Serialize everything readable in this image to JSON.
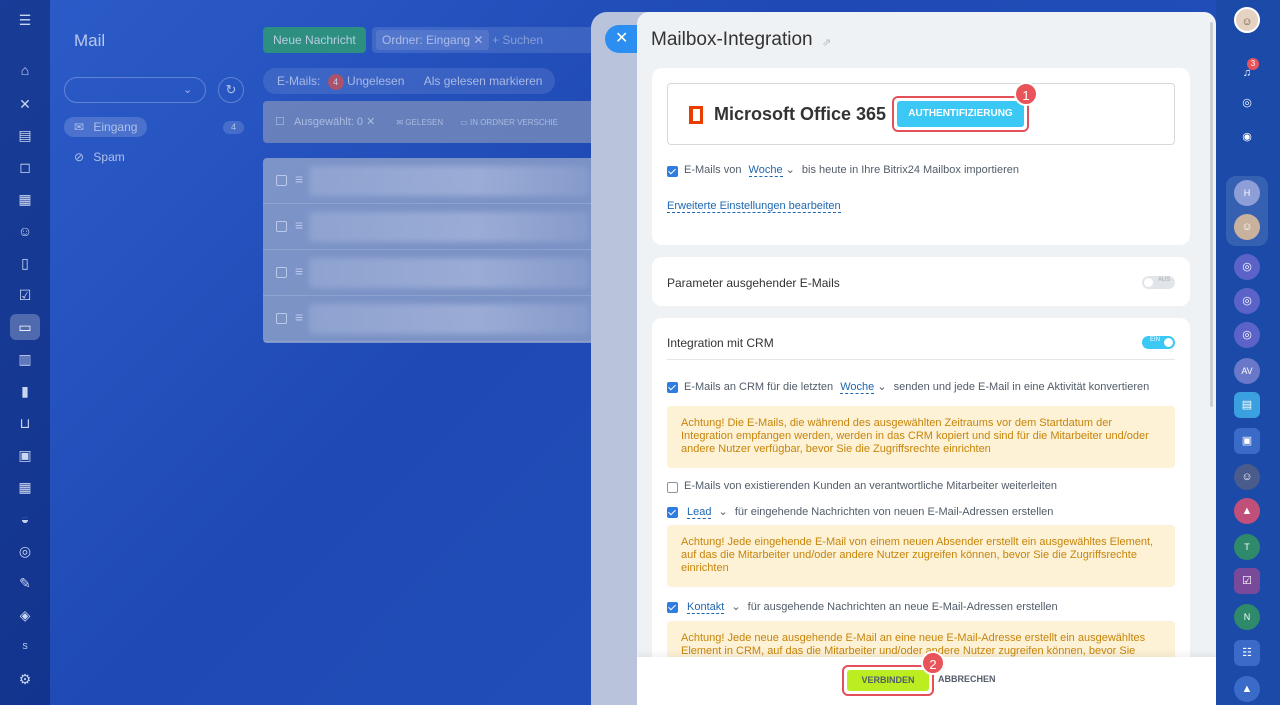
{
  "mail": {
    "title": "Mail",
    "new_message": "Neue Nachricht",
    "search_tag": "Ordner: Eingang",
    "search_placeholder": "+ Suchen",
    "filter_label": "E-Mails:",
    "unread_count": "4",
    "unread_label": "Ungelesen",
    "mark_read": "Als gelesen markieren",
    "folders": [
      {
        "label": "Eingang",
        "count": "4"
      },
      {
        "label": "Spam"
      }
    ],
    "action_bar": {
      "selected": "Ausgewählt: 0",
      "read": "GELESEN",
      "move": "IN ORDNER VERSCHIE"
    }
  },
  "panel": {
    "title": "Mailbox-Integration",
    "provider": "Microsoft Office 365",
    "auth_button": "AUTHENTIFIZIERUNG",
    "step1": "1",
    "import": {
      "prefix": "E-Mails von",
      "period": "Woche",
      "suffix": "bis heute in Ihre Bitrix24 Mailbox importieren"
    },
    "advanced_link": "Erweiterte Einstellungen bearbeiten",
    "outgoing": {
      "title": "Parameter ausgehender E-Mails",
      "toggle": "AUS"
    },
    "crm": {
      "title": "Integration mit CRM",
      "toggle": "EIN",
      "send": {
        "prefix": "E-Mails an CRM für die letzten",
        "period": "Woche",
        "suffix": "senden und jede E-Mail in eine Aktivität konvertieren"
      },
      "warning1": "Achtung! Die E-Mails, die während des ausgewählten Zeitraums vor dem Startdatum der Integration empfangen werden, werden in das CRM kopiert und sind für die Mitarbeiter und/oder andere Nutzer verfügbar, bevor Sie die Zugriffsrechte einrichten",
      "forward": "E-Mails von existierenden Kunden an verantwortliche Mitarbeiter weiterleiten",
      "lead": {
        "entity": "Lead",
        "suffix": "für eingehende Nachrichten von neuen E-Mail-Adressen erstellen"
      },
      "warning2": "Achtung! Jede eingehende E-Mail von einem neuen Absender erstellt ein ausgewähltes Element, auf das die Mitarbeiter und/oder andere Nutzer zugreifen können, bevor Sie die Zugriffsrechte einrichten",
      "contact": {
        "entity": "Kontakt",
        "suffix": "für ausgehende Nachrichten an neue E-Mail-Adressen erstellen"
      },
      "warning3": "Achtung! Jede neue ausgehende E-Mail an eine neue E-Mail-Adresse erstellt ein ausgewähltes Element in CRM, auf das die Mitarbeiter und/oder andere Nutzer zugreifen können, bevor Sie"
    },
    "connect_button": "VERBINDEN",
    "cancel_button": "ABBRECHEN",
    "step2": "2"
  },
  "right_rail": {
    "notifications": "3",
    "avatars": [
      "H",
      "AV",
      "T",
      "N"
    ],
    "left_s": "S"
  },
  "colors": {
    "accent": "#3bc8f5",
    "connect": "#bbed21",
    "highlight": "#e3505a",
    "warning_bg": "#fdf1d6",
    "warning_text": "#c7850a"
  }
}
